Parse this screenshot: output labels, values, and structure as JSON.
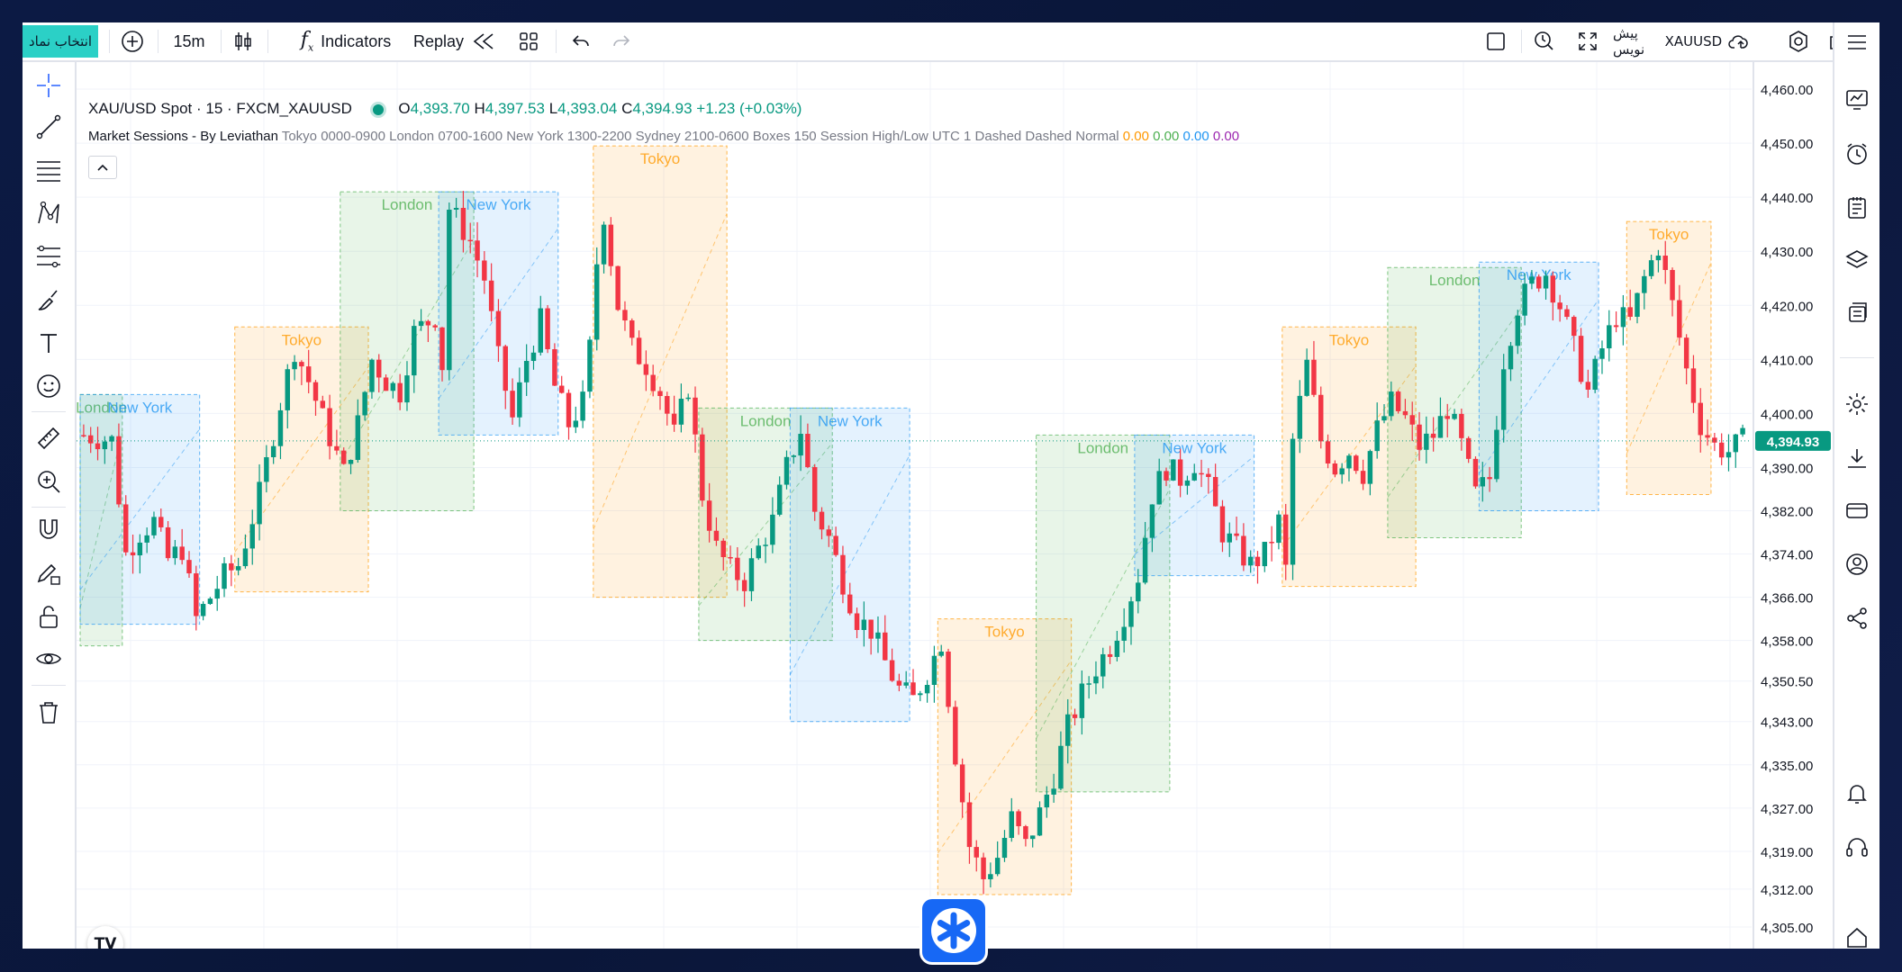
{
  "toolbar": {
    "symbol_button": "انتخاب نماد",
    "interval": "15m",
    "indicators_label": "Indicators",
    "replay_label": "Replay",
    "symbol_right": "XAUUSD",
    "symbol_right_prefix": "پیش نویس"
  },
  "legend": {
    "title": "XAU/USD Spot · 15 · FXCM_XAUUSD",
    "o_label": "O",
    "o": "4,393.70",
    "h_label": "H",
    "h": "4,397.53",
    "l_label": "L",
    "l": "4,393.04",
    "c_label": "C",
    "c": "4,394.93",
    "change": "+1.23 (+0.03%)",
    "indicator_name": "Market Sessions - By Leviathan",
    "indicator_params": "Tokyo 0000-0900 London 0700-1600 New York 1300-2200 Sydney 2100-0600 Boxes 150 Session High/Low UTC 1 Dashed Dashed Normal",
    "indicator_values": [
      "0.00",
      "0.00",
      "0.00",
      "0.00"
    ]
  },
  "colors": {
    "accent": "#2bd0c6",
    "up": "#089981",
    "down": "#f23645",
    "tokyo": "#ff9800",
    "london": "#4caf50",
    "newyork": "#2196f3",
    "sydney": "#9c27b0",
    "price_badge": "#089981"
  },
  "chart_data": {
    "type": "candlestick",
    "symbol": "XAU/USD Spot · 15 · FXCM_XAUUSD",
    "last_price": "4,394.93",
    "y_ticks": [
      "4,460.00",
      "4,450.00",
      "4,440.00",
      "4,430.00",
      "4,420.00",
      "4,410.00",
      "4,400.00",
      "4,390.00",
      "4,382.00",
      "4,374.00",
      "4,366.00",
      "4,358.00",
      "4,350.50",
      "4,343.00",
      "4,335.00",
      "4,327.00",
      "4,319.00",
      "4,312.00",
      "4,305.00"
    ],
    "ylim": [
      4301,
      4465
    ],
    "session_boxes": [
      {
        "name": "London",
        "kind": "london",
        "x0": 0,
        "x1": 6,
        "low": 4357,
        "high": 4403.5
      },
      {
        "name": "New York",
        "kind": "newyork",
        "x0": 0,
        "x1": 17,
        "low": 4361,
        "high": 4403.5
      },
      {
        "name": "Tokyo",
        "kind": "tokyo",
        "x0": 22,
        "x1": 41,
        "low": 4367,
        "high": 4416
      },
      {
        "name": "London",
        "kind": "london",
        "x0": 37,
        "x1": 56,
        "low": 4382,
        "high": 4441
      },
      {
        "name": "New York",
        "kind": "newyork",
        "x0": 51,
        "x1": 68,
        "low": 4396,
        "high": 4441
      },
      {
        "name": "Tokyo",
        "kind": "tokyo",
        "x0": 73,
        "x1": 92,
        "low": 4366,
        "high": 4449.5
      },
      {
        "name": "London",
        "kind": "london",
        "x0": 88,
        "x1": 107,
        "low": 4358,
        "high": 4401
      },
      {
        "name": "New York",
        "kind": "newyork",
        "x0": 101,
        "x1": 118,
        "low": 4343,
        "high": 4401
      },
      {
        "name": "Tokyo",
        "kind": "tokyo",
        "x0": 122,
        "x1": 141,
        "low": 4311,
        "high": 4362
      },
      {
        "name": "London",
        "kind": "london",
        "x0": 136,
        "x1": 155,
        "low": 4330,
        "high": 4396
      },
      {
        "name": "New York",
        "kind": "newyork",
        "x0": 150,
        "x1": 167,
        "low": 4370,
        "high": 4396
      },
      {
        "name": "Tokyo",
        "kind": "tokyo",
        "x0": 171,
        "x1": 190,
        "low": 4368,
        "high": 4416
      },
      {
        "name": "London",
        "kind": "london",
        "x0": 186,
        "x1": 205,
        "low": 4377,
        "high": 4427
      },
      {
        "name": "New York",
        "kind": "newyork",
        "x0": 199,
        "x1": 216,
        "low": 4382,
        "high": 4428
      },
      {
        "name": "Tokyo",
        "kind": "tokyo",
        "x0": 220,
        "x1": 232,
        "low": 4385,
        "high": 4435.5
      }
    ],
    "price_path": [
      [
        0,
        4396
      ],
      [
        4,
        4395
      ],
      [
        6,
        4374
      ],
      [
        8,
        4378
      ],
      [
        10,
        4380
      ],
      [
        12,
        4373
      ],
      [
        14,
        4375
      ],
      [
        16,
        4362
      ],
      [
        18,
        4366
      ],
      [
        20,
        4370
      ],
      [
        22,
        4372
      ],
      [
        25,
        4385
      ],
      [
        28,
        4402
      ],
      [
        30,
        4412
      ],
      [
        32,
        4406
      ],
      [
        34,
        4399
      ],
      [
        37,
        4389
      ],
      [
        39,
        4398
      ],
      [
        41,
        4410
      ],
      [
        43,
        4406
      ],
      [
        45,
        4404
      ],
      [
        47,
        4415
      ],
      [
        50,
        4418
      ],
      [
        51,
        4409
      ],
      [
        52,
        4438
      ],
      [
        55,
        4432
      ],
      [
        57,
        4425
      ],
      [
        59,
        4410
      ],
      [
        61,
        4399
      ],
      [
        63,
        4410
      ],
      [
        65,
        4417
      ],
      [
        67,
        4405
      ],
      [
        69,
        4398
      ],
      [
        71,
        4402
      ],
      [
        72,
        4412
      ],
      [
        73,
        4428
      ],
      [
        74,
        4437
      ],
      [
        76,
        4420
      ],
      [
        78,
        4412
      ],
      [
        80,
        4409
      ],
      [
        82,
        4404
      ],
      [
        84,
        4396
      ],
      [
        86,
        4405
      ],
      [
        88,
        4385
      ],
      [
        90,
        4375
      ],
      [
        92,
        4371
      ],
      [
        94,
        4369
      ],
      [
        96,
        4375
      ],
      [
        98,
        4380
      ],
      [
        100,
        4390
      ],
      [
        102,
        4397
      ],
      [
        104,
        4382
      ],
      [
        106,
        4377
      ],
      [
        108,
        4369
      ],
      [
        110,
        4362
      ],
      [
        112,
        4360
      ],
      [
        114,
        4354
      ],
      [
        116,
        4349
      ],
      [
        118,
        4347
      ],
      [
        120,
        4352
      ],
      [
        122,
        4358
      ],
      [
        124,
        4337
      ],
      [
        126,
        4320
      ],
      [
        128,
        4314
      ],
      [
        130,
        4318
      ],
      [
        132,
        4325
      ],
      [
        134,
        4320
      ],
      [
        136,
        4326
      ],
      [
        138,
        4333
      ],
      [
        140,
        4342
      ],
      [
        142,
        4348
      ],
      [
        144,
        4353
      ],
      [
        146,
        4357
      ],
      [
        148,
        4363
      ],
      [
        150,
        4370
      ],
      [
        152,
        4385
      ],
      [
        154,
        4390
      ],
      [
        156,
        4388
      ],
      [
        158,
        4391
      ],
      [
        160,
        4386
      ],
      [
        162,
        4378
      ],
      [
        164,
        4375
      ],
      [
        166,
        4372
      ],
      [
        168,
        4374
      ],
      [
        170,
        4380
      ],
      [
        171,
        4371
      ],
      [
        172,
        4395
      ],
      [
        174,
        4409
      ],
      [
        176,
        4395
      ],
      [
        178,
        4390
      ],
      [
        180,
        4393
      ],
      [
        182,
        4389
      ],
      [
        184,
        4397
      ],
      [
        186,
        4402
      ],
      [
        188,
        4399
      ],
      [
        190,
        4394
      ],
      [
        192,
        4396
      ],
      [
        194,
        4401
      ],
      [
        196,
        4394
      ],
      [
        198,
        4385
      ],
      [
        200,
        4388
      ],
      [
        202,
        4410
      ],
      [
        204,
        4420
      ],
      [
        206,
        4424
      ],
      [
        208,
        4426
      ],
      [
        210,
        4420
      ],
      [
        212,
        4412
      ],
      [
        214,
        4404
      ],
      [
        216,
        4412
      ],
      [
        218,
        4418
      ],
      [
        220,
        4417
      ],
      [
        222,
        4425
      ],
      [
        224,
        4431
      ],
      [
        226,
        4420
      ],
      [
        228,
        4408
      ],
      [
        230,
        4398
      ],
      [
        232,
        4394
      ],
      [
        234,
        4393
      ],
      [
        236,
        4394.93
      ]
    ]
  }
}
